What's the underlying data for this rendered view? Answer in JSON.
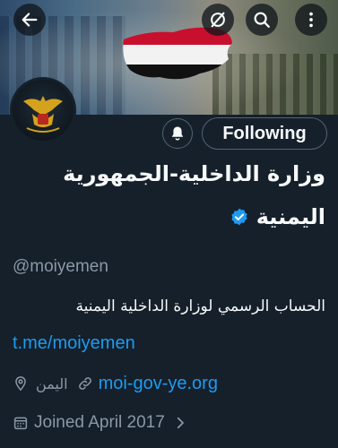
{
  "nav": {
    "back_icon": "arrow-left-icon",
    "mute_icon": "slash-circle-icon",
    "search_icon": "search-icon",
    "more_icon": "more-vertical-icon"
  },
  "profile": {
    "name_line1": "وزارة الداخلية-الجمهورية",
    "name_line2": "اليمنية",
    "handle": "@moiyemen",
    "bio": "الحساب الرسمي لوزارة الداخلية اليمنية",
    "bio_link": "t.me/moiyemen",
    "location": "اليمن",
    "website": "moi-gov-ye.org",
    "joined": "Joined April 2017"
  },
  "actions": {
    "following_label": "Following"
  },
  "colors": {
    "background": "#15202b",
    "accent": "#1d9bf0",
    "muted": "#8b98a5",
    "verified": "#1d9bf0"
  }
}
